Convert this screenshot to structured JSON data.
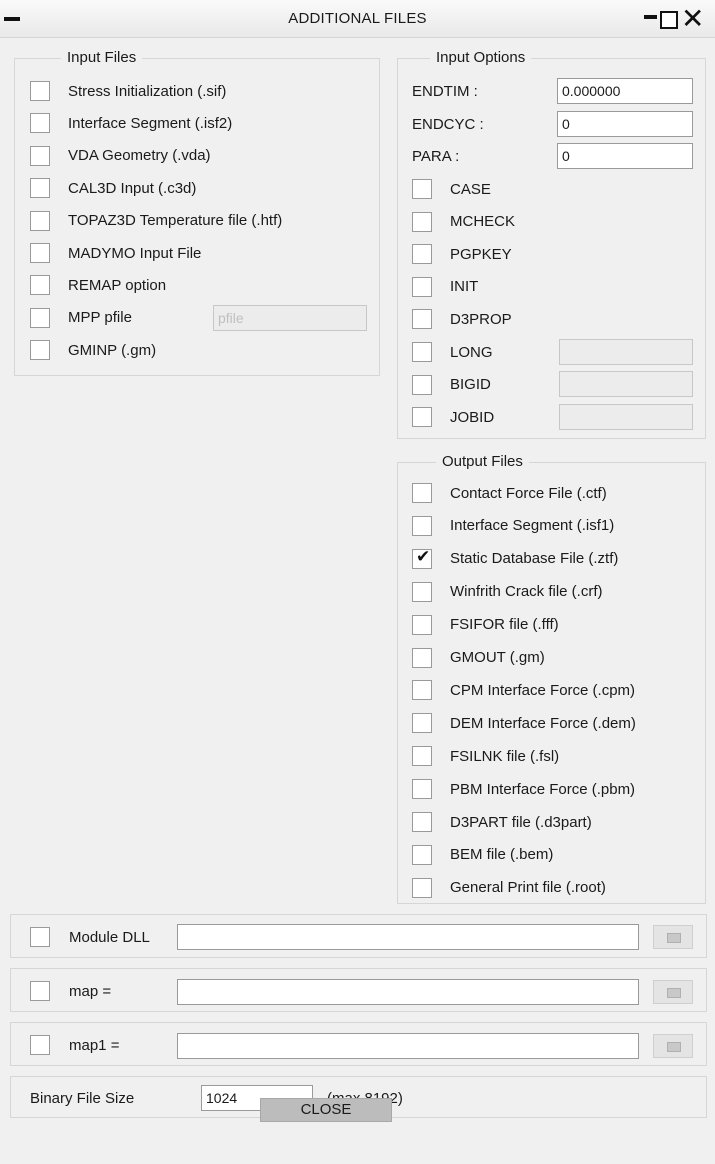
{
  "window": {
    "title": "ADDITIONAL FILES"
  },
  "input_files": {
    "legend": "Input Files",
    "items": [
      {
        "label": "Stress Initialization (.sif)",
        "checked": false
      },
      {
        "label": "Interface Segment (.isf2)",
        "checked": false
      },
      {
        "label": "VDA Geometry (.vda)",
        "checked": false
      },
      {
        "label": "CAL3D Input (.c3d)",
        "checked": false
      },
      {
        "label": "TOPAZ3D Temperature file (.htf)",
        "checked": false
      },
      {
        "label": "MADYMO Input File",
        "checked": false
      },
      {
        "label": "REMAP option",
        "checked": false
      },
      {
        "label": "MPP pfile",
        "checked": false
      },
      {
        "label": "GMINP (.gm)",
        "checked": false
      }
    ],
    "mpp_pfile_value": "pfile"
  },
  "input_options": {
    "legend": "Input Options",
    "endtim": {
      "label": "ENDTIM :",
      "value": "0.000000"
    },
    "endcyc": {
      "label": "ENDCYC :",
      "value": "0"
    },
    "para": {
      "label": "PARA :",
      "value": "0"
    },
    "checks": [
      {
        "label": "CASE",
        "checked": false
      },
      {
        "label": "MCHECK",
        "checked": false
      },
      {
        "label": "PGPKEY",
        "checked": false
      },
      {
        "label": "INIT",
        "checked": false
      },
      {
        "label": "D3PROP",
        "checked": false
      },
      {
        "label": "LONG",
        "checked": false
      },
      {
        "label": "BIGID",
        "checked": false
      },
      {
        "label": "JOBID",
        "checked": false
      }
    ]
  },
  "output_files": {
    "legend": "Output Files",
    "items": [
      {
        "label": "Contact Force File (.ctf)",
        "checked": false
      },
      {
        "label": "Interface Segment (.isf1)",
        "checked": false
      },
      {
        "label": "Static Database File (.ztf)",
        "checked": true
      },
      {
        "label": "Winfrith Crack file (.crf)",
        "checked": false
      },
      {
        "label": "FSIFOR file (.fff)",
        "checked": false
      },
      {
        "label": "GMOUT (.gm)",
        "checked": false
      },
      {
        "label": "CPM Interface Force (.cpm)",
        "checked": false
      },
      {
        "label": "DEM Interface Force (.dem)",
        "checked": false
      },
      {
        "label": "FSILNK file (.fsl)",
        "checked": false
      },
      {
        "label": "PBM Interface Force (.pbm)",
        "checked": false
      },
      {
        "label": "D3PART file (.d3part)",
        "checked": false
      },
      {
        "label": "BEM file (.bem)",
        "checked": false
      },
      {
        "label": "General Print file (.root)",
        "checked": false
      }
    ]
  },
  "module_dll": {
    "label": "Module DLL",
    "value": ""
  },
  "map": {
    "label": "map =",
    "value": ""
  },
  "map1": {
    "label": "map1 =",
    "value": ""
  },
  "binary_size": {
    "label": "Binary File Size",
    "value": "1024",
    "hint": "(max 8192)"
  },
  "close_label": "CLOSE"
}
